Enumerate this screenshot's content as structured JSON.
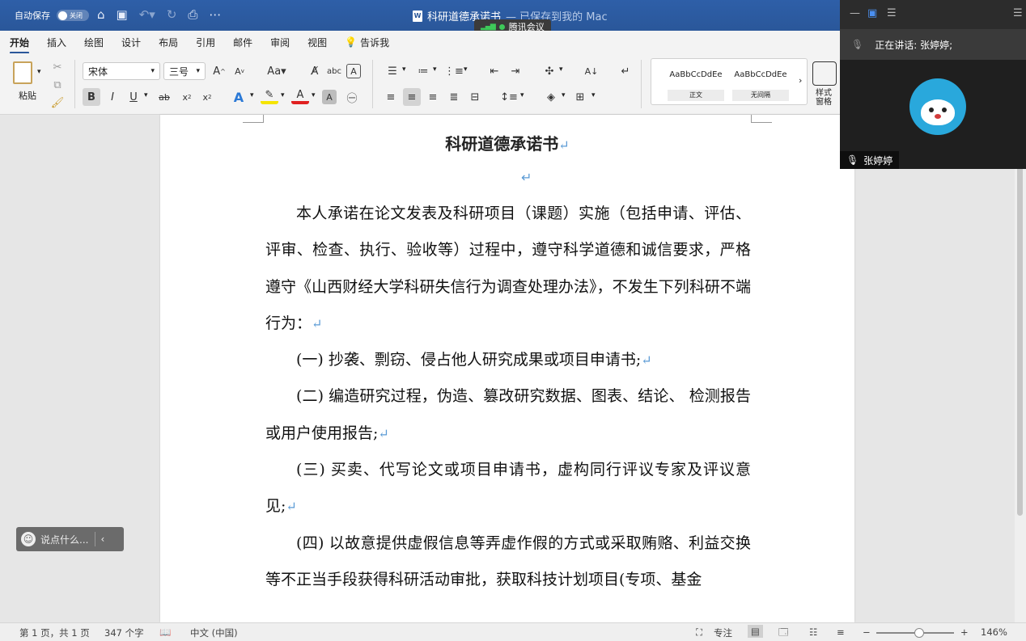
{
  "titlebar": {
    "autosave_label": "自动保存",
    "autosave_state": "关闭",
    "doc_title": "科研道德承诺书",
    "saved_status": "— 已保存到我的 Mac",
    "doc_icon": "W",
    "tencent_meeting": "腾讯会议"
  },
  "menu": {
    "tabs": [
      "开始",
      "插入",
      "绘图",
      "设计",
      "布局",
      "引用",
      "邮件",
      "审阅",
      "视图"
    ],
    "tell_me": "告诉我"
  },
  "ribbon": {
    "paste_label": "粘贴",
    "font_name": "宋体",
    "font_size": "三号",
    "style_normal_sample": "AaBbCcDdEe",
    "style_normal_name": "正文",
    "style_nospacing_sample": "AaBbCcDdEe",
    "style_nospacing_name": "无间隔",
    "styles_pane_label": "样式窗格",
    "font_color_hex": "#e02020",
    "highlight_color_hex": "#f5e400",
    "accent_color_hex": "#2b579a"
  },
  "document": {
    "title": "科研道德承诺书",
    "return_mark": "↵",
    "paragraphs": [
      "本人承诺在论文发表及科研项目（课题）实施（包括申请、评估、评审、检查、执行、验收等）过程中，遵守科学道德和诚信要求，严格遵守《山西财经大学科研失信行为调查处理办法》，不发生下列科研不端行为：",
      "(一) 抄袭、剽窃、侵占他人研究成果或项目申请书;",
      "(二) 编造研究过程，伪造、篡改研究数据、图表、结论、 检测报告或用户使用报告;",
      "(三) 买卖、代写论文或项目申请书，虚构同行评议专家及评议意见;",
      "(四) 以故意提供虚假信息等弄虚作假的方式或采取贿赂、利益交换等不正当手段获得科研活动审批，获取科技计划项目(专项、基金"
    ]
  },
  "chat": {
    "placeholder": "说点什么..."
  },
  "statusbar": {
    "page_info": "第 1 页，共 1 页",
    "word_count": "347 个字",
    "language": "中文 (中国)",
    "focus_label": "专注",
    "zoom_level": "146%",
    "zoom_fraction": 0.55
  },
  "meeting": {
    "speaking": "正在讲话: 张婷婷;",
    "participant_name": "张婷婷"
  }
}
